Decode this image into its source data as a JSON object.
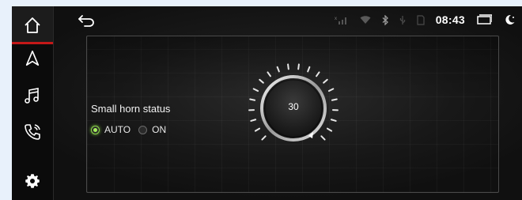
{
  "sidebar": {
    "items": [
      {
        "name": "home",
        "icon": "home-icon",
        "active": true
      },
      {
        "name": "navigation",
        "icon": "navigation-arrow-icon",
        "active": false
      },
      {
        "name": "music",
        "icon": "music-note-icon",
        "active": false
      },
      {
        "name": "phone",
        "icon": "phone-icon",
        "active": false
      },
      {
        "name": "settings",
        "icon": "gear-icon",
        "active": false
      }
    ]
  },
  "status_bar": {
    "time": "08:43",
    "icons": [
      "signal-icon",
      "wifi-icon",
      "bluetooth-icon",
      "usb-icon",
      "sd-card-icon",
      "window-icon",
      "night-mode-icon"
    ]
  },
  "horn": {
    "label": "Small horn status",
    "options": [
      {
        "label": "AUTO",
        "selected": true
      },
      {
        "label": "ON",
        "selected": false
      }
    ]
  },
  "knob": {
    "value": "30"
  },
  "colors": {
    "accent_active": "#c41818",
    "radio_on": "#8ad24a"
  }
}
